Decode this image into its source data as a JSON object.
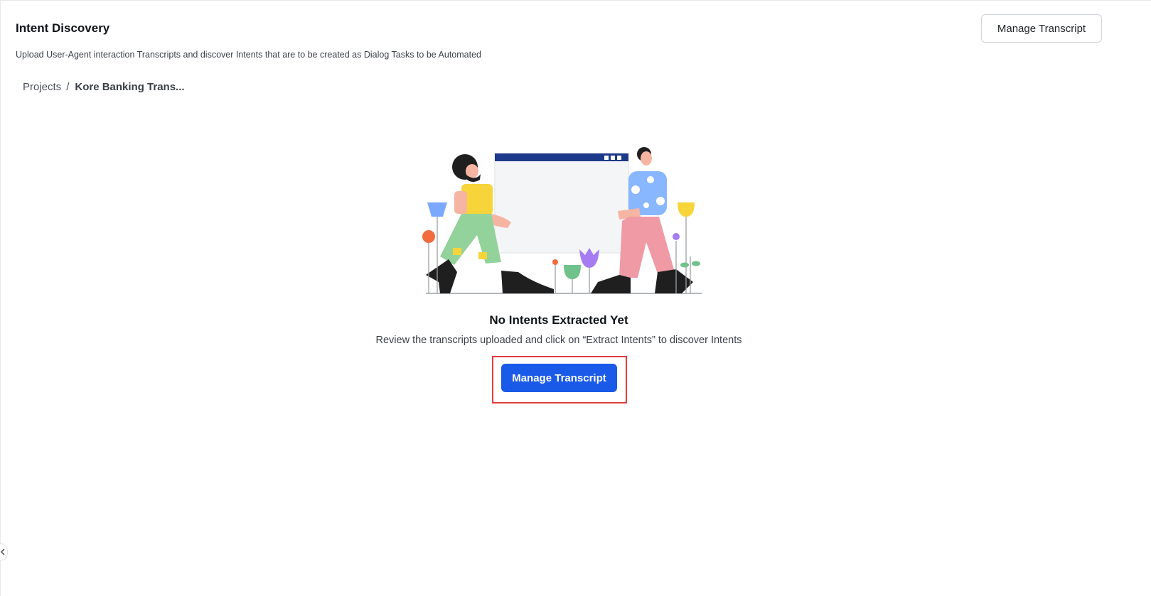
{
  "header": {
    "title": "Intent Discovery",
    "subtitle": "Upload User-Agent interaction Transcripts and discover Intents that are to be created as Dialog Tasks to be Automated",
    "manage_button_label": "Manage Transcript"
  },
  "breadcrumb": {
    "root": "Projects",
    "separator": "/",
    "current": "Kore Banking Trans..."
  },
  "empty_state": {
    "title": "No Intents Extracted Yet",
    "description": "Review the transcripts uploaded and click on “Extract Intents” to discover Intents",
    "button_label": "Manage Transcript",
    "illustration": "two-people-holding-blank-window-illustration"
  },
  "colors": {
    "primary": "#1a5ae8",
    "highlight": "#e03c3c"
  },
  "icons": {
    "collapse": "chevron-left-icon"
  }
}
